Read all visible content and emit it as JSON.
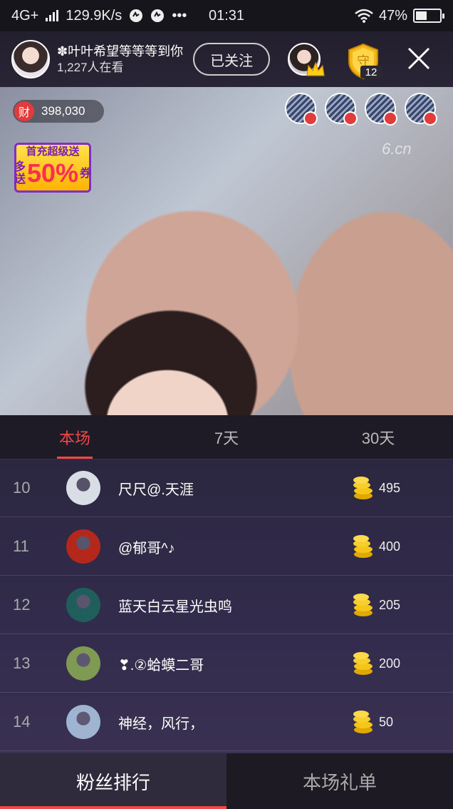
{
  "status_bar": {
    "network": "4G+",
    "speed": "129.9K/s",
    "dots": "•••",
    "time": "01:31",
    "battery": "47%",
    "battery_level": 0.47
  },
  "header": {
    "host_name": "✽叶叶希望等等等到你",
    "viewers": "1,227人在看",
    "follow_label": "已关注",
    "guard_count": "12",
    "guard_badge_char": "守"
  },
  "video": {
    "wealth_icon_label": "财",
    "wealth_value": "398,030",
    "promo_line1": "首充超级送",
    "promo_small_left": "多送",
    "promo_big": "50%",
    "promo_small_right": "券",
    "watermark": "6.cn",
    "viewer_avatar_count": 4
  },
  "tabs": [
    {
      "label": "本场",
      "active": true
    },
    {
      "label": "7天",
      "active": false
    },
    {
      "label": "30天",
      "active": false
    }
  ],
  "rank_list": [
    {
      "rank": "10",
      "name": "尺尺@.天涯",
      "amount": "495",
      "avatar": "#d9dde6"
    },
    {
      "rank": "11",
      "name": "@郁哥^♪",
      "amount": "400",
      "avatar": "#b4281c"
    },
    {
      "rank": "12",
      "name": "蓝天白云星光虫鸣",
      "amount": "205",
      "avatar": "#1f5e5b"
    },
    {
      "rank": "13",
      "name": "❣.②蛤蟆二哥",
      "amount": "200",
      "avatar": "#7f9a52"
    },
    {
      "rank": "14",
      "name": "神经，风行，",
      "amount": "50",
      "avatar": "#9fb4d1"
    }
  ],
  "bottom_tabs": [
    {
      "label": "粉丝排行",
      "active": true
    },
    {
      "label": "本场礼单",
      "active": false
    }
  ],
  "colors": {
    "accent_red": "#f04848",
    "coin_gold": "#f5c518"
  }
}
